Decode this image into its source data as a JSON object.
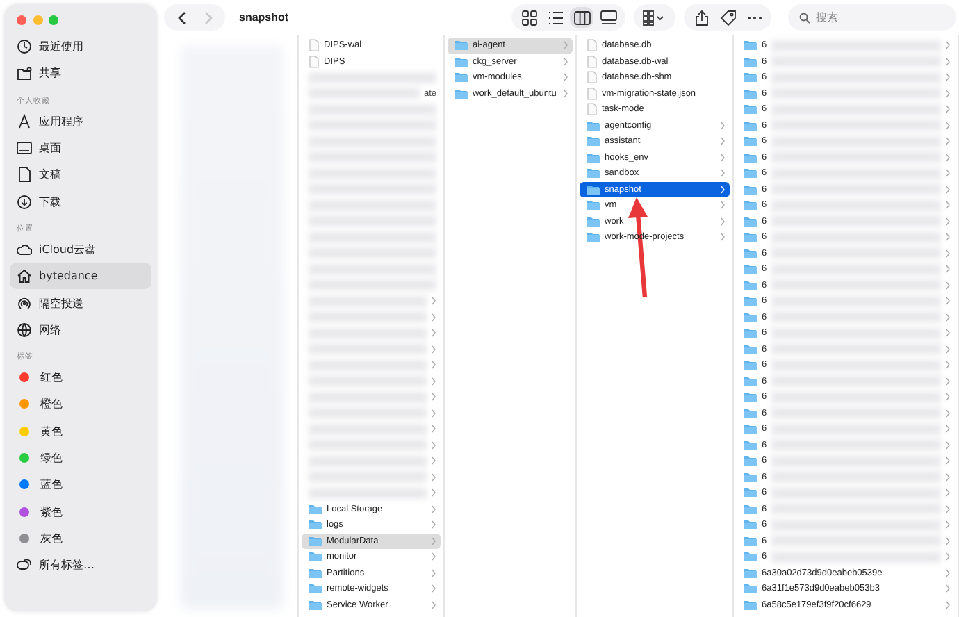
{
  "window": {
    "title": "snapshot"
  },
  "toolbar": {
    "back_disabled": false,
    "forward_disabled": true,
    "views": [
      {
        "selected": false
      },
      {
        "selected": false
      },
      {
        "selected": true
      },
      {
        "selected": false
      }
    ],
    "search": {
      "placeholder": "搜索"
    }
  },
  "sidebar": {
    "sections": [
      {
        "items": [
          {
            "label": "最近使用",
            "kind": "place",
            "selected": false
          },
          {
            "label": "共享",
            "kind": "place",
            "selected": false
          }
        ]
      },
      {
        "heading": "个人收藏",
        "items": [
          {
            "label": "应用程序",
            "kind": "place",
            "selected": false
          },
          {
            "label": "桌面",
            "kind": "place",
            "selected": false
          },
          {
            "label": "文稿",
            "kind": "place",
            "selected": false
          },
          {
            "label": "下载",
            "kind": "place",
            "selected": false
          }
        ]
      },
      {
        "heading": "位置",
        "items": [
          {
            "label": "iCloud云盘",
            "kind": "place",
            "selected": false
          },
          {
            "label": "bytedance",
            "kind": "place",
            "selected": true
          },
          {
            "label": "隔空投送",
            "kind": "place",
            "selected": false
          },
          {
            "label": "网络",
            "kind": "place",
            "selected": false
          }
        ]
      },
      {
        "heading": "标签",
        "items": [
          {
            "label": "红色",
            "kind": "tag",
            "color": "#ff3b30",
            "selected": false
          },
          {
            "label": "橙色",
            "kind": "tag",
            "color": "#ff9500",
            "selected": false
          },
          {
            "label": "黄色",
            "kind": "tag",
            "color": "#ffcc00",
            "selected": false
          },
          {
            "label": "绿色",
            "kind": "tag",
            "color": "#28cd41",
            "selected": false
          },
          {
            "label": "蓝色",
            "kind": "tag",
            "color": "#007aff",
            "selected": false
          },
          {
            "label": "紫色",
            "kind": "tag",
            "color": "#af52de",
            "selected": false
          },
          {
            "label": "灰色",
            "kind": "tag",
            "color": "#8e8e93",
            "selected": false
          },
          {
            "label": "所有标签…",
            "kind": "place",
            "selected": false
          }
        ]
      }
    ]
  },
  "columns": [
    {
      "redacted": true
    },
    {
      "rows": [
        {
          "kind": "file",
          "label": "DIPS-wal",
          "selected": false
        },
        {
          "kind": "file",
          "label": "DIPS",
          "selected": false
        },
        {
          "kind": "redacted",
          "folder": false,
          "selected": false
        },
        {
          "kind": "redacted",
          "folder": false,
          "tail": "ate",
          "selected": false
        },
        {
          "kind": "redacted",
          "folder": false,
          "selected": false
        },
        {
          "kind": "redacted",
          "folder": false,
          "selected": false
        },
        {
          "kind": "redacted",
          "folder": false,
          "selected": false
        },
        {
          "kind": "redacted",
          "folder": false,
          "selected": false
        },
        {
          "kind": "redacted",
          "folder": false,
          "selected": false
        },
        {
          "kind": "redacted",
          "folder": false,
          "selected": false
        },
        {
          "kind": "redacted",
          "folder": false,
          "selected": false
        },
        {
          "kind": "redacted",
          "folder": false,
          "selected": false
        },
        {
          "kind": "redacted",
          "folder": false,
          "selected": false
        },
        {
          "kind": "redacted",
          "folder": false,
          "selected": false
        },
        {
          "kind": "redacted",
          "folder": false,
          "selected": false
        },
        {
          "kind": "redacted",
          "folder": false,
          "selected": false
        },
        {
          "kind": "redacted",
          "folder": true,
          "selected": false
        },
        {
          "kind": "redacted",
          "folder": true,
          "selected": false
        },
        {
          "kind": "redacted",
          "folder": true,
          "selected": false
        },
        {
          "kind": "redacted",
          "folder": true,
          "selected": false
        },
        {
          "kind": "redacted",
          "folder": true,
          "selected": false
        },
        {
          "kind": "redacted",
          "folder": true,
          "selected": false
        },
        {
          "kind": "redacted",
          "folder": true,
          "selected": false
        },
        {
          "kind": "redacted",
          "folder": true,
          "selected": false
        },
        {
          "kind": "redacted",
          "folder": true,
          "selected": false
        },
        {
          "kind": "redacted",
          "folder": true,
          "selected": false
        },
        {
          "kind": "redacted",
          "folder": true,
          "selected": false
        },
        {
          "kind": "redacted",
          "folder": true,
          "selected": false
        },
        {
          "kind": "redacted",
          "folder": true,
          "selected": false
        },
        {
          "kind": "folder",
          "label": "Local Storage",
          "selected": false
        },
        {
          "kind": "folder",
          "label": "logs",
          "selected": false
        },
        {
          "kind": "folder",
          "label": "ModularData",
          "selected": true,
          "focused": false
        },
        {
          "kind": "folder",
          "label": "monitor",
          "selected": false
        },
        {
          "kind": "folder",
          "label": "Partitions",
          "selected": false
        },
        {
          "kind": "folder",
          "label": "remote-widgets",
          "selected": false
        },
        {
          "kind": "folder",
          "label": "Service Worker",
          "selected": false
        }
      ]
    },
    {
      "rows": [
        {
          "kind": "folder",
          "label": "ai-agent",
          "selected": true,
          "focused": false
        },
        {
          "kind": "folder",
          "label": "ckg_server",
          "selected": false
        },
        {
          "kind": "folder",
          "label": "vm-modules",
          "selected": false
        },
        {
          "kind": "folder",
          "label": "work_default_ubuntu",
          "selected": false
        }
      ]
    },
    {
      "rows": [
        {
          "kind": "file",
          "label": "database.db",
          "selected": false
        },
        {
          "kind": "file",
          "label": "database.db-wal",
          "selected": false
        },
        {
          "kind": "file",
          "label": "database.db-shm",
          "selected": false
        },
        {
          "kind": "file",
          "label": "vm-migration-state.json",
          "selected": false
        },
        {
          "kind": "file",
          "label": "task-mode",
          "selected": false
        },
        {
          "kind": "folder",
          "label": "agentconfig",
          "selected": false
        },
        {
          "kind": "folder",
          "label": "assistant",
          "selected": false
        },
        {
          "kind": "folder",
          "label": "hooks_env",
          "selected": false
        },
        {
          "kind": "folder",
          "label": "sandbox",
          "selected": false
        },
        {
          "kind": "folder",
          "label": "snapshot",
          "selected": true,
          "focused": true
        },
        {
          "kind": "folder",
          "label": "vm",
          "selected": false
        },
        {
          "kind": "folder",
          "label": "work",
          "selected": false
        },
        {
          "kind": "folder",
          "label": "work-mode-projects",
          "selected": false
        }
      ]
    },
    {
      "rows": [
        {
          "kind": "redacted",
          "folder": true,
          "label": "6",
          "selected": false
        },
        {
          "kind": "redacted",
          "folder": true,
          "label": "6",
          "selected": false
        },
        {
          "kind": "redacted",
          "folder": true,
          "label": "6",
          "selected": false
        },
        {
          "kind": "redacted",
          "folder": true,
          "label": "6",
          "selected": false
        },
        {
          "kind": "redacted",
          "folder": true,
          "label": "6",
          "selected": false
        },
        {
          "kind": "redacted",
          "folder": true,
          "label": "6",
          "selected": false
        },
        {
          "kind": "redacted",
          "folder": true,
          "label": "6",
          "selected": false
        },
        {
          "kind": "redacted",
          "folder": true,
          "label": "6",
          "selected": false
        },
        {
          "kind": "redacted",
          "folder": true,
          "label": "6",
          "selected": false
        },
        {
          "kind": "redacted",
          "folder": true,
          "label": "6",
          "selected": false
        },
        {
          "kind": "redacted",
          "folder": true,
          "label": "6",
          "selected": false
        },
        {
          "kind": "redacted",
          "folder": true,
          "label": "6",
          "selected": false
        },
        {
          "kind": "redacted",
          "folder": true,
          "label": "6",
          "selected": false
        },
        {
          "kind": "redacted",
          "folder": true,
          "label": "6",
          "selected": false
        },
        {
          "kind": "redacted",
          "folder": true,
          "label": "6",
          "selected": false
        },
        {
          "kind": "redacted",
          "folder": true,
          "label": "6",
          "selected": false
        },
        {
          "kind": "redacted",
          "folder": true,
          "label": "6",
          "selected": false
        },
        {
          "kind": "redacted",
          "folder": true,
          "label": "6",
          "selected": false
        },
        {
          "kind": "redacted",
          "folder": true,
          "label": "6",
          "selected": false
        },
        {
          "kind": "redacted",
          "folder": true,
          "label": "6",
          "selected": false
        },
        {
          "kind": "redacted",
          "folder": true,
          "label": "6",
          "selected": false
        },
        {
          "kind": "redacted",
          "folder": true,
          "label": "6",
          "selected": false
        },
        {
          "kind": "redacted",
          "folder": true,
          "label": "6",
          "selected": false
        },
        {
          "kind": "redacted",
          "folder": true,
          "label": "6",
          "selected": false
        },
        {
          "kind": "redacted",
          "folder": true,
          "label": "6",
          "selected": false
        },
        {
          "kind": "redacted",
          "folder": true,
          "label": "6",
          "selected": false
        },
        {
          "kind": "redacted",
          "folder": true,
          "label": "6",
          "selected": false
        },
        {
          "kind": "redacted",
          "folder": true,
          "label": "6",
          "selected": false
        },
        {
          "kind": "redacted",
          "folder": true,
          "label": "6",
          "selected": false
        },
        {
          "kind": "redacted",
          "folder": true,
          "label": "6",
          "selected": false
        },
        {
          "kind": "redacted",
          "folder": true,
          "label": "6",
          "selected": false
        },
        {
          "kind": "redacted",
          "folder": true,
          "label": "6",
          "selected": false
        },
        {
          "kind": "redacted",
          "folder": true,
          "label": "6",
          "selected": false
        },
        {
          "kind": "folder",
          "label": "6a30a02d73d9d0eabeb0539e",
          "selected": false
        },
        {
          "kind": "folder",
          "label": "6a31f1e573d9d0eabeb053b3",
          "selected": false
        },
        {
          "kind": "folder",
          "label": "6a58c5e179ef3f9f20cf6629",
          "selected": false
        }
      ]
    }
  ],
  "overlay": {
    "kind": "arrow"
  }
}
